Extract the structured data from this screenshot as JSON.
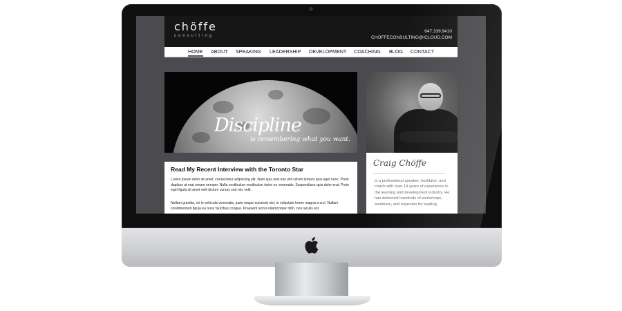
{
  "site": {
    "logo": "chöffe",
    "logo_sub": "consulting",
    "phone": "647.339.9410",
    "email": "CHOFFECONSULTING@ICLOUD.COM"
  },
  "nav": {
    "items": [
      {
        "label": "HOME",
        "active": true
      },
      {
        "label": "ABOUT"
      },
      {
        "label": "SPEAKING"
      },
      {
        "label": "LEADERSHIP"
      },
      {
        "label": "DEVELOPMENT"
      },
      {
        "label": "COACHING"
      },
      {
        "label": "BLOG"
      },
      {
        "label": "CONTACT"
      }
    ]
  },
  "hero": {
    "title": "Discipline",
    "subtitle": "is remembering what you want."
  },
  "article": {
    "title": "Read My Recent Interview with the Toronto Star",
    "para1": "Lorem ipsum dolor sit amet, consectetur adipiscing elit. Nam quis erat non elit rutrum tempor quis eget nunc. Proin dapibus at erat ornare semper. Nulla vestibulum vestibulum tortor eu venenatis. Suspendisse quis dolor erat. Proin eget ligula sit amet velit dictum cursus sed nec velit.",
    "para2": "Nullam gravida, mi in vehicula venenatis, justo neque euismod nisl, in vulputate lorem magna a orci. Nullam condimentum ligula eu nunc faucibus congue. Praesent luctus ullamcorper nibh, non iaculis est"
  },
  "bio": {
    "name": "Craig Chöffe",
    "text": "is a professional speaker, facilitator, and coach with over 19 years of experience in the learning and development industry. He has delivered hundreds of workshops, seminars, and keynotes for leading"
  },
  "colors": {
    "screen_bg": "#4b4b4f",
    "header_bg": "#161616",
    "nav_bg": "#ffffff"
  },
  "icons": {
    "monitor_logo": "apple-logo-icon",
    "camera": "camera-icon"
  }
}
